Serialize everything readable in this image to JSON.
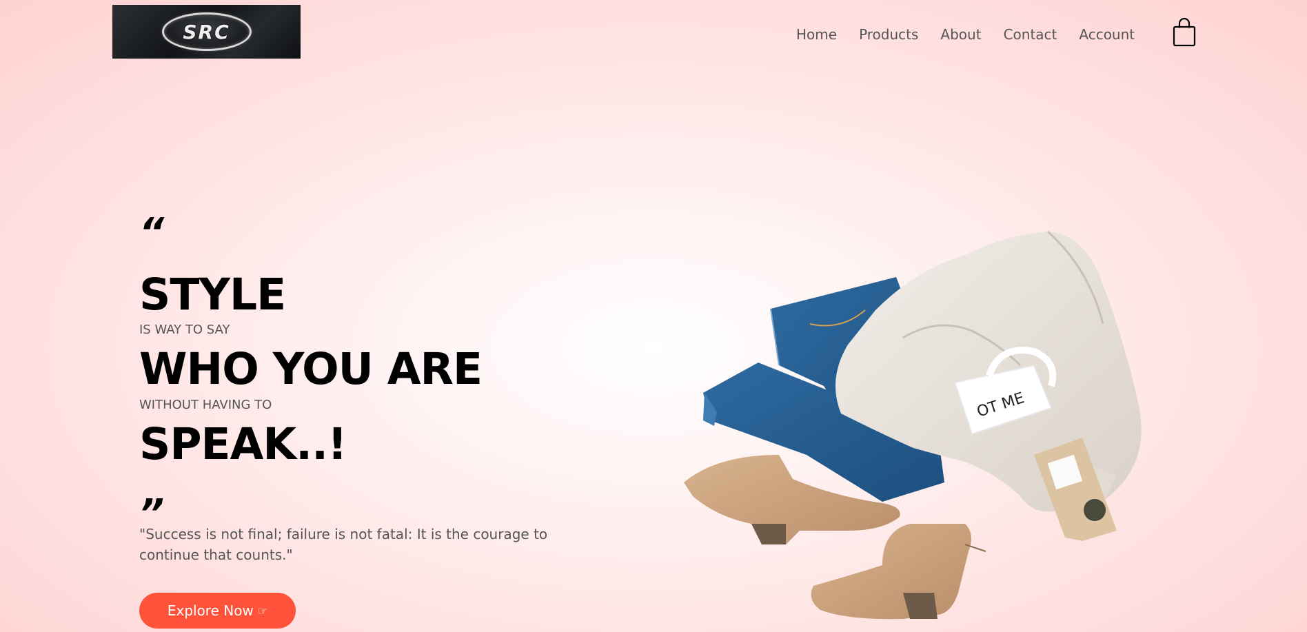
{
  "header": {
    "logo_text": "SRC",
    "nav": [
      {
        "label": "Home"
      },
      {
        "label": "Products"
      },
      {
        "label": "About"
      },
      {
        "label": "Contact"
      },
      {
        "label": "Account"
      }
    ],
    "cart_icon": "shopping-bag-icon"
  },
  "hero": {
    "quote_open": "“",
    "line1": "STYLE",
    "sub1": "IS WAY TO SAY",
    "line2": "WHO YOU ARE",
    "sub2": "WITHOUT HAVING TO",
    "line3": "SPEAK..!",
    "quote_close": "”",
    "quote": "\"Success is not final; failure is not fatal: It is the courage to continue that counts.\"",
    "button_label": "Explore Now",
    "button_icon": "☞"
  },
  "colors": {
    "accent": "#ff523b",
    "background_center": "#ffffff",
    "background_edge": "#ffd2d2",
    "text_muted": "#555555"
  }
}
